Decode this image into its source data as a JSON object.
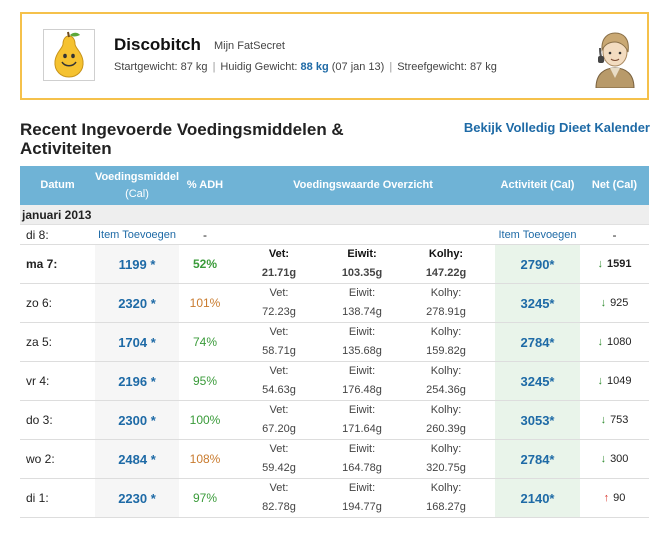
{
  "profile": {
    "username": "Discobitch",
    "subtitle": "Mijn FatSecret",
    "start_weight": "Startgewicht: 87 kg",
    "current_weight_label": "Huidig Gewicht:",
    "current_weight_value": "88 kg",
    "current_weight_date": "(07 jan 13)",
    "goal_weight": "Streefgewicht: 87 kg"
  },
  "section": {
    "title": "Recent Ingevoerde Voedingsmiddelen & Activiteiten",
    "calendar_link": "Bekijk Volledig Dieet Kalender"
  },
  "table": {
    "headers": {
      "date": "Datum",
      "food": "Voedingsmiddel",
      "food_unit": "(Cal)",
      "adh": "% ADH",
      "overview": "Voedingswaarde Overzicht",
      "activity": "Activiteit (Cal)",
      "net": "Net (Cal)"
    },
    "month": "januari 2013",
    "empty_row": {
      "date": "di 8:",
      "food_link": "Item Toevoegen",
      "adh": "-",
      "activity_link": "Item Toevoegen",
      "net": "-"
    },
    "rows": [
      {
        "date": "ma 7:",
        "food": "1199 *",
        "adh": "52%",
        "vet_label": "Vet:",
        "vet": "21.71g",
        "eiwit_label": "Eiwit:",
        "eiwit": "103.35g",
        "kolhy_label": "Kolhy:",
        "kolhy": "147.22g",
        "activity": "2790*",
        "net": "1591",
        "direction": "down"
      },
      {
        "date": "zo 6:",
        "food": "2320 *",
        "adh": "101%",
        "vet_label": "Vet:",
        "vet": "72.23g",
        "eiwit_label": "Eiwit:",
        "eiwit": "138.74g",
        "kolhy_label": "Kolhy:",
        "kolhy": "278.91g",
        "activity": "3245*",
        "net": "925",
        "direction": "down"
      },
      {
        "date": "za 5:",
        "food": "1704 *",
        "adh": "74%",
        "vet_label": "Vet:",
        "vet": "58.71g",
        "eiwit_label": "Eiwit:",
        "eiwit": "135.68g",
        "kolhy_label": "Kolhy:",
        "kolhy": "159.82g",
        "activity": "2784*",
        "net": "1080",
        "direction": "down"
      },
      {
        "date": "vr 4:",
        "food": "2196 *",
        "adh": "95%",
        "vet_label": "Vet:",
        "vet": "54.63g",
        "eiwit_label": "Eiwit:",
        "eiwit": "176.48g",
        "kolhy_label": "Kolhy:",
        "kolhy": "254.36g",
        "activity": "3245*",
        "net": "1049",
        "direction": "down"
      },
      {
        "date": "do 3:",
        "food": "2300 *",
        "adh": "100%",
        "vet_label": "Vet:",
        "vet": "67.20g",
        "eiwit_label": "Eiwit:",
        "eiwit": "171.64g",
        "kolhy_label": "Kolhy:",
        "kolhy": "260.39g",
        "activity": "3053*",
        "net": "753",
        "direction": "down"
      },
      {
        "date": "wo 2:",
        "food": "2484 *",
        "adh": "108%",
        "vet_label": "Vet:",
        "vet": "59.42g",
        "eiwit_label": "Eiwit:",
        "eiwit": "164.78g",
        "kolhy_label": "Kolhy:",
        "kolhy": "320.75g",
        "activity": "2784*",
        "net": "300",
        "direction": "down"
      },
      {
        "date": "di 1:",
        "food": "2230 *",
        "adh": "97%",
        "vet_label": "Vet:",
        "vet": "82.78g",
        "eiwit_label": "Eiwit:",
        "eiwit": "194.77g",
        "kolhy_label": "Kolhy:",
        "kolhy": "168.27g",
        "activity": "2140*",
        "net": "90",
        "direction": "up"
      }
    ]
  },
  "icons": {
    "pear": "pear-logo-icon",
    "avatar": "user-avatar-icon",
    "down": "arrow-down-icon",
    "up": "arrow-up-icon"
  },
  "colors": {
    "header_bg": "#6fb3d6",
    "link": "#1e6aa6",
    "profile_border": "#f5c14b",
    "activity_bg": "#e9f4ea",
    "pct_green": "#3a9b3a",
    "pct_orange": "#c97b2e"
  }
}
